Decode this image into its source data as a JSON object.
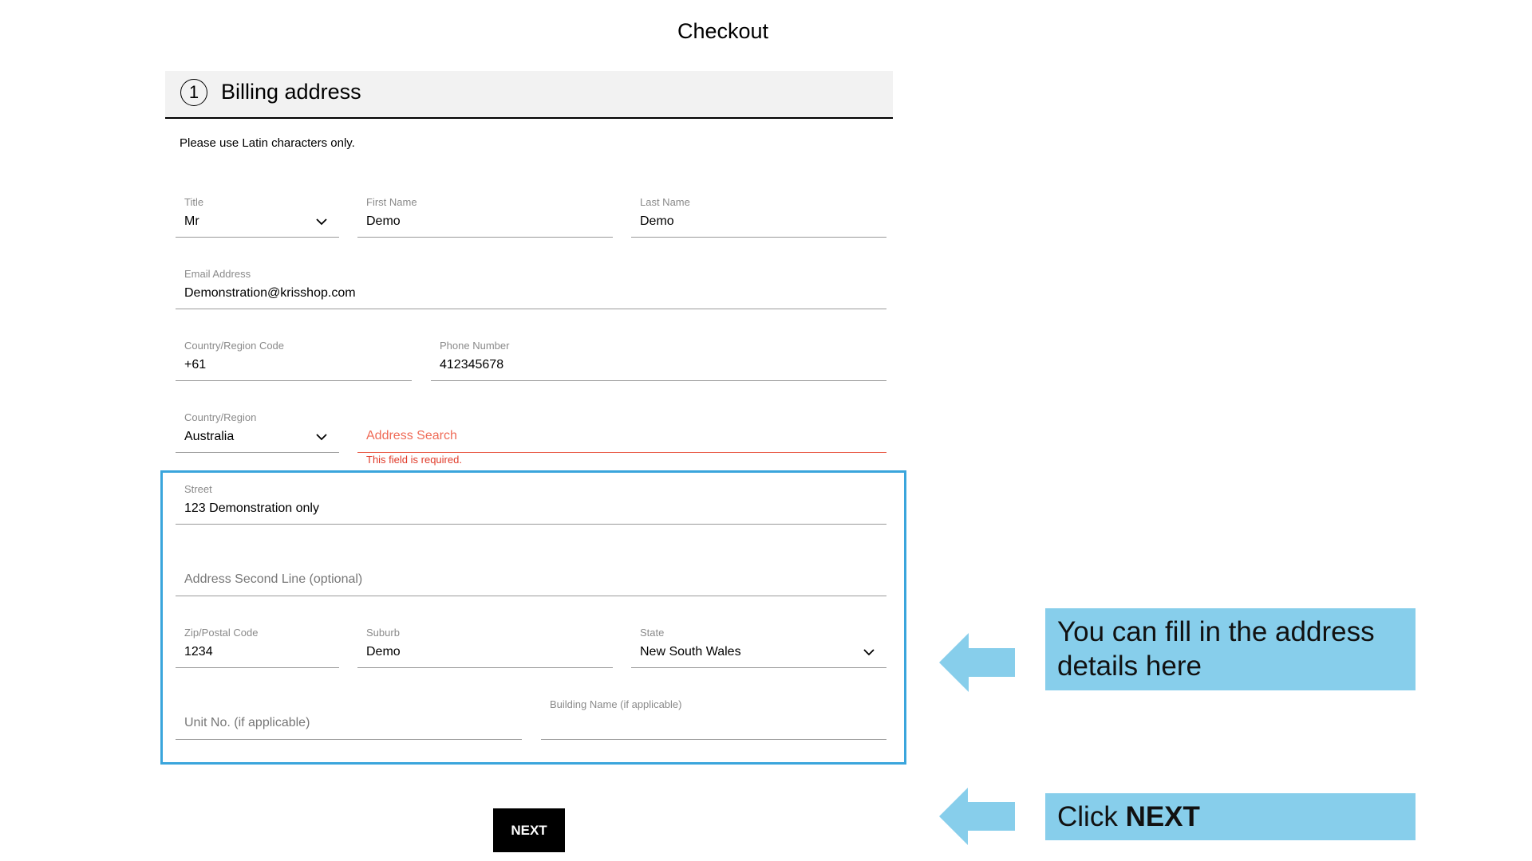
{
  "page": {
    "title": "Checkout"
  },
  "section": {
    "step": "1",
    "title": "Billing address",
    "note": "Please use Latin characters only."
  },
  "form": {
    "title": {
      "label": "Title",
      "value": "Mr"
    },
    "first_name": {
      "label": "First Name",
      "value": "Demo"
    },
    "last_name": {
      "label": "Last Name",
      "value": "Demo"
    },
    "email": {
      "label": "Email Address",
      "value": "Demonstration@krisshop.com"
    },
    "country_code": {
      "label": "Country/Region Code",
      "value": "+61"
    },
    "phone": {
      "label": "Phone Number",
      "value": "412345678"
    },
    "country": {
      "label": "Country/Region",
      "value": "Australia"
    },
    "address_search": {
      "placeholder": "Address Search",
      "error": "This field is required."
    },
    "street": {
      "label": "Street",
      "value": "123 Demonstration only"
    },
    "address_line2": {
      "placeholder": "Address Second Line (optional)"
    },
    "zip": {
      "label": "Zip/Postal Code",
      "value": "1234"
    },
    "suburb": {
      "label": "Suburb",
      "value": "Demo"
    },
    "state": {
      "label": "State",
      "value": "New South Wales"
    },
    "unit": {
      "placeholder": "Unit No. (if applicable)"
    },
    "building": {
      "label": "Building Name (if applicable)"
    }
  },
  "actions": {
    "next_label": "NEXT"
  },
  "annotations": {
    "address_callout": "You can fill in the address details here",
    "next_callout_prefix": "Click ",
    "next_callout_bold": "NEXT"
  },
  "colors": {
    "highlight": "#3aa5dc",
    "callout_bg": "#87ceeb",
    "error": "#e03a28"
  }
}
